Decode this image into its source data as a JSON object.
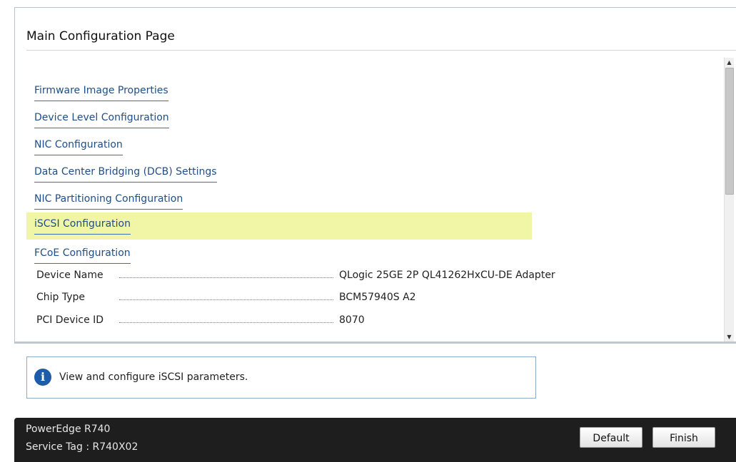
{
  "page": {
    "title": "Main Configuration Page"
  },
  "menu": {
    "items": [
      {
        "label": "Firmware Image Properties",
        "selected": false
      },
      {
        "label": "Device Level Configuration",
        "selected": false
      },
      {
        "label": "NIC Configuration",
        "selected": false
      },
      {
        "label": "Data Center Bridging (DCB) Settings",
        "selected": false
      },
      {
        "label": "NIC Partitioning Configuration",
        "selected": false
      },
      {
        "label": "iSCSI Configuration",
        "selected": true
      },
      {
        "label": "FCoE Configuration",
        "selected": false
      }
    ]
  },
  "device_info": [
    {
      "label": "Device Name",
      "value": "QLogic 25GE 2P QL41262HxCU-DE Adapter"
    },
    {
      "label": "Chip Type",
      "value": "BCM57940S A2"
    },
    {
      "label": "PCI Device ID",
      "value": "8070"
    }
  ],
  "help": {
    "icon": "info-icon",
    "text": "View and configure iSCSI parameters."
  },
  "footer": {
    "model": "PowerEdge R740",
    "service_tag": "Service Tag : R740X02",
    "default_label": "Default",
    "finish_label": "Finish"
  },
  "colors": {
    "selected_highlight": "#f1f5a6",
    "link": "#1f4e87",
    "footer_bg": "#1e1e1e",
    "info_icon": "#1c5ca8"
  }
}
